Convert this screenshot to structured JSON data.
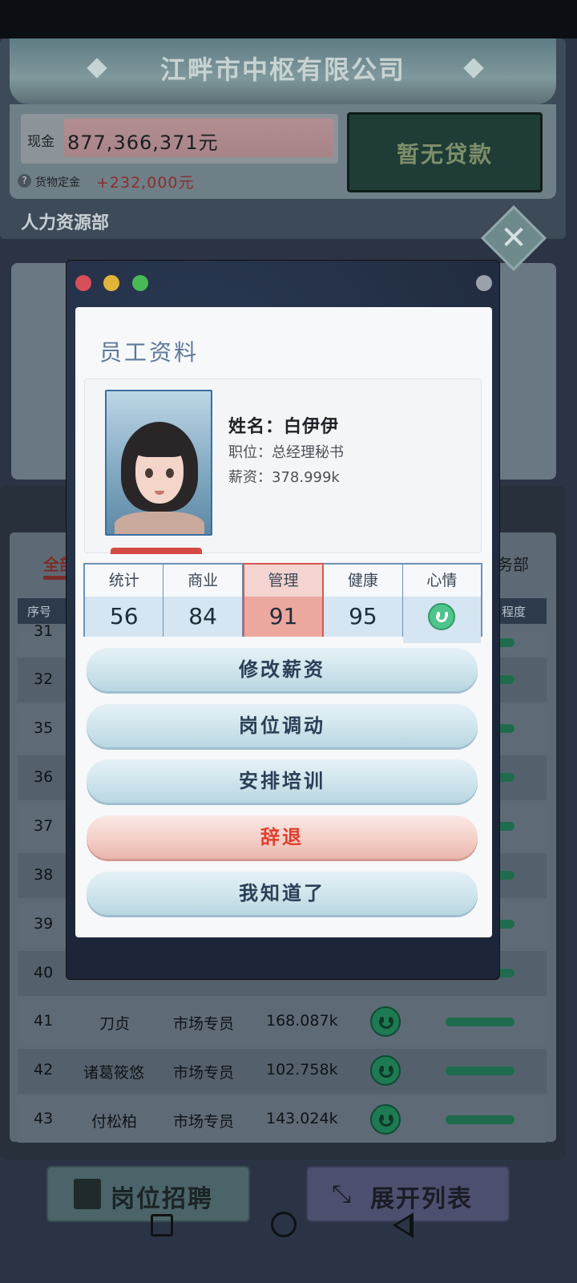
{
  "company": {
    "name": "江畔市中枢有限公司"
  },
  "finance": {
    "cash_label": "现金",
    "cash_value": "877,366,371元",
    "goods_label": "货物定金",
    "goods_value": "+232,000元",
    "loan_label": "暂无贷款"
  },
  "department": {
    "title": "人力资源部"
  },
  "list": {
    "tab_all": "全部",
    "tab_business": "务部",
    "col_seq": "序号",
    "col_degree": "程度",
    "rows": [
      {
        "seq": "31"
      },
      {
        "seq": "32"
      },
      {
        "seq": "35"
      },
      {
        "seq": "36"
      },
      {
        "seq": "37"
      },
      {
        "seq": "38"
      },
      {
        "seq": "39"
      },
      {
        "seq": "40"
      },
      {
        "seq": "41",
        "name": "刀贞",
        "position": "市场专员",
        "salary": "168.087k"
      },
      {
        "seq": "42",
        "name": "诸葛筱悠",
        "position": "市场专员",
        "salary": "102.758k"
      },
      {
        "seq": "43",
        "name": "付松柏",
        "position": "市场专员",
        "salary": "143.024k"
      }
    ]
  },
  "bottom_buttons": {
    "recruit": "岗位招聘",
    "expand": "展开列表"
  },
  "modal": {
    "title": "员工资料",
    "employee": {
      "name_line": "姓名：白伊伊",
      "position_line": "职位：总经理秘书",
      "salary_line": "薪资：378.999k"
    },
    "stats": [
      {
        "label": "统计",
        "value": "56"
      },
      {
        "label": "商业",
        "value": "84"
      },
      {
        "label": "管理",
        "value": "91",
        "highlight": true
      },
      {
        "label": "健康",
        "value": "95"
      },
      {
        "label": "心情",
        "icon": "smiley-icon"
      }
    ],
    "actions": {
      "adjust_salary": "修改薪资",
      "transfer": "岗位调动",
      "training": "安排培训",
      "dismiss": "辞退",
      "ok": "我知道了"
    }
  },
  "colors": {
    "accent_red": "#e0402f",
    "stat_highlight": "#eca79f",
    "title_blue": "#5e7999",
    "mood_green": "#4fc48c"
  }
}
